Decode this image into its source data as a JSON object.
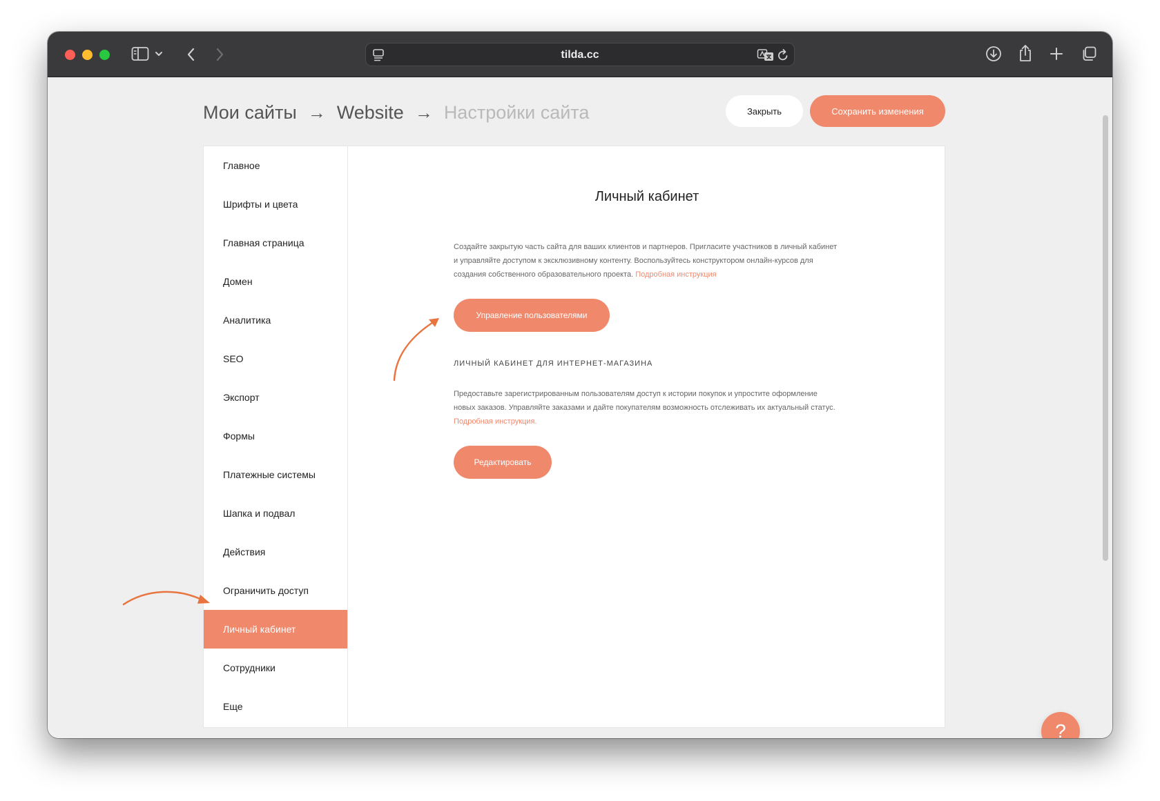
{
  "browser": {
    "url": "tilda.cc"
  },
  "breadcrumb": {
    "items": [
      "Мои сайты",
      "Website",
      "Настройки сайта"
    ],
    "separator": "→"
  },
  "header": {
    "close_label": "Закрыть",
    "save_label": "Сохранить изменения"
  },
  "sidebar": {
    "items": [
      {
        "label": "Главное"
      },
      {
        "label": "Шрифты и цвета"
      },
      {
        "label": "Главная страница"
      },
      {
        "label": "Домен"
      },
      {
        "label": "Аналитика"
      },
      {
        "label": "SEO"
      },
      {
        "label": "Экспорт"
      },
      {
        "label": "Формы"
      },
      {
        "label": "Платежные системы"
      },
      {
        "label": "Шапка и подвал"
      },
      {
        "label": "Действия"
      },
      {
        "label": "Ограничить доступ"
      },
      {
        "label": "Личный кабинет"
      },
      {
        "label": "Сотрудники"
      },
      {
        "label": "Еще"
      }
    ],
    "active_index": 12
  },
  "main": {
    "title": "Личный кабинет",
    "description": "Создайте закрытую часть сайта для ваших клиентов и партнеров. Пригласите участников в личный кабинет и управляйте доступом к эксклюзивному контенту. Воспользуйтесь конструктором онлайн-курсов для создания собственного образовательного проекта.",
    "description_link": "Подробная инструкция",
    "manage_users_label": "Управление пользователями",
    "shop_section_title": "ЛИЧНЫЙ КАБИНЕТ ДЛЯ ИНТЕРНЕТ-МАГАЗИНА",
    "shop_description": "Предоставьте зарегистрированным пользователям доступ к истории покупок и упростите оформление новых заказов. Управляйте заказами и дайте покупателям возможность отслеживать их актуальный статус.",
    "shop_description_link": "Подробная инструкция.",
    "edit_label": "Редактировать"
  },
  "help": {
    "label": "?"
  },
  "colors": {
    "accent": "#f0886c",
    "background": "#efefef",
    "titlebar": "#3a3a3c",
    "annotation": "#e8743f"
  }
}
